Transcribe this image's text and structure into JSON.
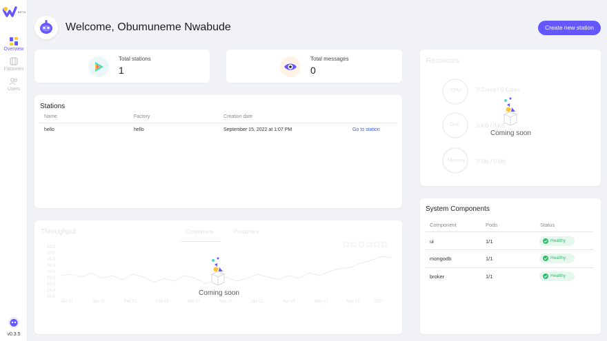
{
  "sidebar": {
    "logo_badge": "BETA",
    "items": [
      {
        "label": "Overview",
        "icon": "overview-icon",
        "active": true
      },
      {
        "label": "Factories",
        "icon": "factories-icon",
        "active": false
      },
      {
        "label": "Users",
        "icon": "users-icon",
        "active": false
      }
    ],
    "version": "v0.3.5"
  },
  "header": {
    "welcome": "Welcome, Obumuneme Nwabude",
    "create_button": "Create new station"
  },
  "stats": {
    "stations": {
      "label": "Total stations",
      "value": "1"
    },
    "messages": {
      "label": "Total messages",
      "value": "0"
    }
  },
  "stations": {
    "title": "Stations",
    "columns": [
      "Name",
      "Factory",
      "Creation date"
    ],
    "rows": [
      {
        "name": "hello",
        "factory": "hello",
        "date": "September 15, 2022 at 1:07 PM",
        "action": "Go to station"
      }
    ]
  },
  "resources": {
    "title": "Resources",
    "coming_soon": "Coming soon",
    "rows": [
      {
        "label": "CPU",
        "value": "0 Cores / 0 Cores"
      },
      {
        "label": "Disk",
        "value": "0 KB / 0 KB"
      },
      {
        "label": "Memory",
        "value": "0 Mb / 0 Mb"
      }
    ]
  },
  "throughput": {
    "title": "Throughput",
    "tabs": [
      "Consumers",
      "Producers"
    ],
    "coming_soon": "Coming soon",
    "y_ticks": [
      "32.0",
      "30.0",
      "28.0",
      "26.0",
      "24.0",
      "22.0",
      "20.0",
      "18.0",
      "16.0"
    ],
    "x_ticks": [
      "Jan 01",
      "Jan 15",
      "Feb 01",
      "Feb 15",
      "Mar 01",
      "Mar 15",
      "Apr 01",
      "Apr 15",
      "May 01",
      "May 15",
      "2022"
    ]
  },
  "system": {
    "title": "System Components",
    "columns": [
      "Component",
      "Pods",
      "Status"
    ],
    "rows": [
      {
        "component": "ui",
        "pods": "1/1",
        "status": "Healthy"
      },
      {
        "component": "mongodb",
        "pods": "1/1",
        "status": "Healthy"
      },
      {
        "component": "broker",
        "pods": "1/1",
        "status": "Healthy"
      }
    ]
  },
  "colors": {
    "accent": "#6557ff",
    "healthy": "#2cbe6f",
    "link": "#3a5bd9"
  }
}
